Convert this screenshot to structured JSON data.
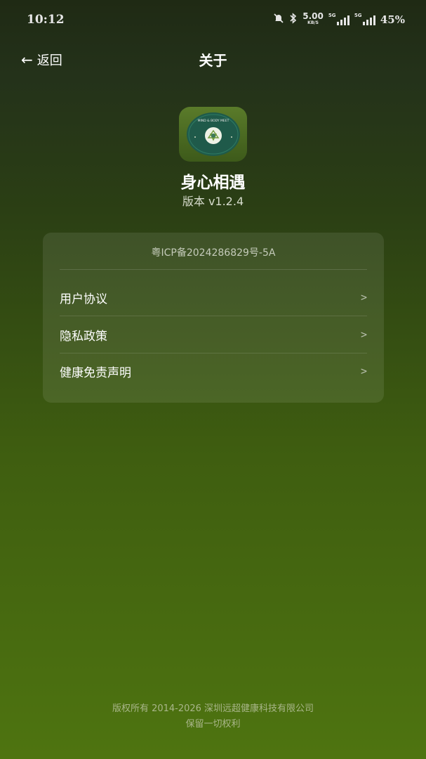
{
  "status_bar": {
    "time": "10:12",
    "speed_value": "5.00",
    "speed_unit": "KB/S",
    "network_1": "5G",
    "network_2": "5G",
    "battery": "45%"
  },
  "header": {
    "back_label": "返回",
    "title": "关于"
  },
  "app": {
    "icon_text": "MIND & BODY MEET",
    "name": "身心相遇",
    "version": "版本 v1.2.4"
  },
  "card": {
    "icp": "粤ICP备2024286829号-5A",
    "items": [
      {
        "label": "用户协议",
        "chevron": ">"
      },
      {
        "label": "隐私政策",
        "chevron": ">"
      },
      {
        "label": "健康免责声明",
        "chevron": ">"
      }
    ]
  },
  "footer": {
    "copyright": "版权所有 2014-2026 深圳远超健康科技有限公司",
    "rights": "保留一切权利"
  },
  "colors": {
    "background_top": "#1f2a14",
    "background_bottom": "#4e7410",
    "card": "#ffffff17",
    "icon_circle": "#1f5a4a"
  }
}
